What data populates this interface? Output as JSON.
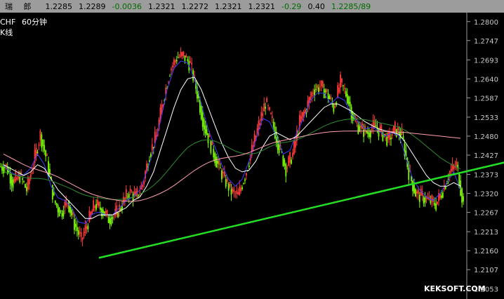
{
  "header": {
    "symbol": "瑞 郎",
    "last": "1.2285",
    "ask": "1.2289",
    "change": "-0.0036",
    "high": "1.2321",
    "low": "1.2272",
    "open": "1.2321",
    "close": "1.2321",
    "pct": "-0.29",
    "ratio": "0.40",
    "bidask": "1.2285/89"
  },
  "overlay": {
    "pair": "CHF",
    "timeframe": "60分钟",
    "type": "K线"
  },
  "watermark": "KEKSOFT.COM",
  "colors": {
    "background": "#000000",
    "frame": "#9c9c9c",
    "up": "#ff3a3a",
    "down": "#7cfc00",
    "ma_fast": "#3b3bff",
    "ma_slow": "#ffffff",
    "ma_mid": "#2e8b2e",
    "ma_long": "#ff9faf",
    "trendline": "#22e022"
  },
  "chart_data": {
    "type": "candlestick",
    "yaxis_ticks": [
      "1.2800",
      "1.2747",
      "1.2693",
      "1.2640",
      "1.2587",
      "1.2533",
      "1.2480",
      "1.2427",
      "1.2373",
      "1.2320",
      "1.2267",
      "1.2213",
      "1.2160",
      "1.2107",
      "1.2053"
    ],
    "ylim": [
      1.2025,
      1.2825
    ],
    "series": [
      {
        "values": [
          1.2395,
          1.235,
          1.237,
          1.233,
          1.2405,
          1.2485,
          1.241,
          1.23,
          1.2265,
          1.23,
          1.2235,
          1.219,
          1.224,
          1.229,
          1.2275,
          1.225,
          1.226,
          1.229,
          1.2325,
          1.231,
          1.2345,
          1.243,
          1.248,
          1.258,
          1.2665,
          1.27,
          1.2705,
          1.268,
          1.26,
          1.251,
          1.2455,
          1.24,
          1.236,
          1.2325,
          1.2315,
          1.237,
          1.244,
          1.251,
          1.2575,
          1.252,
          1.245,
          1.239,
          1.243,
          1.252,
          1.256,
          1.261,
          1.262,
          1.26,
          1.256,
          1.263,
          1.259,
          1.252,
          1.25,
          1.249,
          1.251,
          1.249,
          1.247,
          1.25,
          1.248,
          1.238,
          1.232,
          1.231,
          1.23,
          1.229,
          1.233,
          1.238,
          1.24,
          1.229
        ]
      },
      {
        "values": [
          1.2398,
          1.238,
          1.237,
          1.2372,
          1.239,
          1.243,
          1.24,
          1.234,
          1.2308,
          1.23,
          1.228,
          1.224,
          1.2236,
          1.2262,
          1.2268,
          1.226,
          1.226,
          1.228,
          1.23,
          1.231,
          1.233,
          1.238,
          1.244,
          1.252,
          1.261,
          1.267,
          1.269,
          1.2685,
          1.264,
          1.257,
          1.25,
          1.245,
          1.24,
          1.236,
          1.234,
          1.236,
          1.241,
          1.247,
          1.253,
          1.252,
          1.248,
          1.243,
          1.244,
          1.249,
          1.253,
          1.258,
          1.26,
          1.26,
          1.257,
          1.259,
          1.258,
          1.254,
          1.252,
          1.25,
          1.2505,
          1.2495,
          1.248,
          1.249,
          1.248,
          1.242,
          1.236,
          1.233,
          1.231,
          1.23,
          1.232,
          1.235,
          1.238,
          1.233
        ]
      },
      {
        "values": [
          1.24,
          1.239,
          1.238,
          1.237,
          1.238,
          1.24,
          1.239,
          1.236,
          1.233,
          1.231,
          1.229,
          1.227,
          1.225,
          1.225,
          1.226,
          1.226,
          1.226,
          1.227,
          1.228,
          1.23,
          1.231,
          1.234,
          1.238,
          1.244,
          1.25,
          1.256,
          1.261,
          1.264,
          1.2645,
          1.261,
          1.256,
          1.251,
          1.246,
          1.242,
          1.239,
          1.238,
          1.2385,
          1.241,
          1.245,
          1.248,
          1.249,
          1.248,
          1.247,
          1.248,
          1.25,
          1.252,
          1.254,
          1.256,
          1.257,
          1.257,
          1.256,
          1.255,
          1.2535,
          1.252,
          1.251,
          1.25,
          1.2495,
          1.249,
          1.2485,
          1.246,
          1.243,
          1.24,
          1.237,
          1.235,
          1.234,
          1.234,
          1.235,
          1.234
        ]
      },
      {
        "values": [
          1.238,
          1.2375,
          1.237,
          1.2365,
          1.2362,
          1.2362,
          1.236,
          1.2355,
          1.2348,
          1.234,
          1.2332,
          1.2322,
          1.2315,
          1.231,
          1.2308,
          1.2305,
          1.2303,
          1.2303,
          1.2305,
          1.231,
          1.2318,
          1.2328,
          1.2342,
          1.236,
          1.2382,
          1.2405,
          1.2428,
          1.2448,
          1.246,
          1.2468,
          1.247,
          1.2466,
          1.2458,
          1.2448,
          1.2438,
          1.2432,
          1.243,
          1.2432,
          1.244,
          1.245,
          1.2458,
          1.2462,
          1.2465,
          1.247,
          1.2478,
          1.2488,
          1.2498,
          1.2508,
          1.2516,
          1.2522,
          1.2526,
          1.2528,
          1.2528,
          1.2526,
          1.2522,
          1.2518,
          1.2514,
          1.251,
          1.2505,
          1.2495,
          1.2482,
          1.2468,
          1.2452,
          1.2436,
          1.242,
          1.2408,
          1.2398,
          1.2388
        ]
      },
      {
        "values": [
          1.243,
          1.242,
          1.241,
          1.24,
          1.2392,
          1.2386,
          1.238,
          1.2374,
          1.2366,
          1.2356,
          1.2346,
          1.2336,
          1.2326,
          1.2318,
          1.2312,
          1.2307,
          1.2303,
          1.23,
          1.2298,
          1.2298,
          1.23,
          1.2305,
          1.2312,
          1.232,
          1.233,
          1.2342,
          1.2356,
          1.237,
          1.2384,
          1.2396,
          1.2406,
          1.2413,
          1.2418,
          1.2421,
          1.2424,
          1.2428,
          1.2434,
          1.2442,
          1.245,
          1.2458,
          1.2464,
          1.2468,
          1.2472,
          1.2476,
          1.248,
          1.2484,
          1.2487,
          1.249,
          1.2492,
          1.2493,
          1.2494,
          1.2494,
          1.2494,
          1.2494,
          1.2494,
          1.2494,
          1.2493,
          1.2492,
          1.2491,
          1.249,
          1.2488,
          1.2486,
          1.2484,
          1.2482,
          1.248,
          1.2478,
          1.2476,
          1.2474
        ]
      }
    ],
    "trendline": {
      "from": [
        14,
        1.214
      ],
      "to": [
        86,
        1.2463
      ]
    }
  }
}
